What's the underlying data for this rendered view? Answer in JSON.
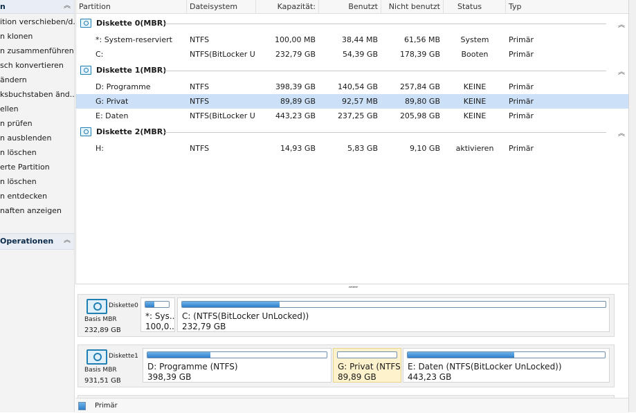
{
  "sidebar": {
    "header_label": "n",
    "items": [
      "ition verschieben/d...",
      "n klonen",
      "n zusammenführen",
      "sch konvertieren",
      "ändern",
      "ksbuchstaben änd...",
      "ellen",
      "n prüfen",
      "n ausblenden",
      "n löschen",
      "erte Partition",
      "n löschen",
      "n entdecken",
      "naften anzeigen"
    ],
    "section2_label": "Operationen"
  },
  "table": {
    "columns": [
      "Partition",
      "Dateisystem",
      "Kapazität:",
      "Benutzt",
      "Nicht benutzt",
      "Status",
      "Typ"
    ],
    "groups": [
      {
        "title": "Diskette 0(MBR)",
        "rows": [
          {
            "partition": "*: System-reserviert",
            "fs": "NTFS",
            "capacity": "100,00 MB",
            "used": "38,44 MB",
            "unused": "61,56 MB",
            "status": "System",
            "type": "Primär"
          },
          {
            "partition": "C:",
            "fs": "NTFS(BitLocker U...",
            "capacity": "232,79 GB",
            "used": "54,39 GB",
            "unused": "178,39 GB",
            "status": "Booten",
            "type": "Primär"
          }
        ]
      },
      {
        "title": "Diskette 1(MBR)",
        "rows": [
          {
            "partition": "D: Programme",
            "fs": "NTFS",
            "capacity": "398,39 GB",
            "used": "140,54 GB",
            "unused": "257,84 GB",
            "status": "KEINE",
            "type": "Primär"
          },
          {
            "partition": "G: Privat",
            "fs": "NTFS",
            "capacity": "89,89 GB",
            "used": "92,57 MB",
            "unused": "89,80 GB",
            "status": "KEINE",
            "type": "Primär"
          },
          {
            "partition": "E: Daten",
            "fs": "NTFS(BitLocker U...",
            "capacity": "443,23 GB",
            "used": "237,25 GB",
            "unused": "205,98 GB",
            "status": "KEINE",
            "type": "Primär"
          }
        ]
      },
      {
        "title": "Diskette 2(MBR)",
        "rows": [
          {
            "partition": "H:",
            "fs": "NTFS",
            "capacity": "14,93 GB",
            "used": "5,83 GB",
            "unused": "9,10 GB",
            "status": "aktivieren",
            "type": "Primär"
          }
        ]
      }
    ]
  },
  "splitter_glyph": ",,,,,,,",
  "diskmap": [
    {
      "name": "Diskette0",
      "type": "Basis MBR",
      "size": "232,89 GB",
      "partitions": [
        {
          "label": "*: Sys...",
          "size": "100,0...",
          "fill": 0.38
        },
        {
          "label": "C: (NTFS(BitLocker UnLocked))",
          "size": "232,79 GB",
          "fill": 0.23
        }
      ]
    },
    {
      "name": "Diskette1",
      "type": "Basis MBR",
      "size": "931,51 GB",
      "partitions": [
        {
          "label": "D: Programme (NTFS)",
          "size": "398,39 GB",
          "fill": 0.35
        },
        {
          "label": "G: Privat (NTFS)",
          "size": "89,89 GB",
          "fill": 0.0
        },
        {
          "label": "E: Daten (NTFS(BitLocker UnLocked))",
          "size": "443,23 GB",
          "fill": 0.54
        }
      ]
    }
  ],
  "legend": {
    "label": "Primär"
  },
  "colors": {
    "selection": "#cce0f7",
    "selected_partition": "#fdf2cc",
    "bar_fill": "#2f7fc9",
    "accent": "#1f7fb3"
  }
}
